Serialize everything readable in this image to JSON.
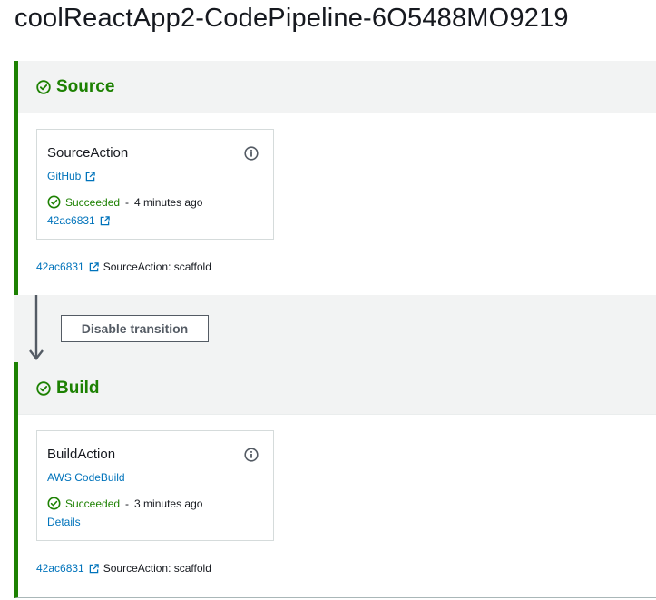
{
  "pipeline": {
    "title": "coolReactApp2-CodePipeline-6O5488MO9219"
  },
  "colors": {
    "success": "#1d8102",
    "link": "#0073bb",
    "text": "#16191f",
    "header_bg": "#f2f3f3"
  },
  "stages": [
    {
      "name": "Source",
      "action": {
        "name": "SourceAction",
        "provider": "GitHub",
        "status": "Succeeded",
        "separator": "-",
        "time": "4 minutes ago",
        "link": "42ac6831"
      },
      "footer": {
        "commit": "42ac6831",
        "message": "SourceAction: scaffold"
      }
    },
    {
      "name": "Build",
      "action": {
        "name": "BuildAction",
        "provider": "AWS CodeBuild",
        "status": "Succeeded",
        "separator": "-",
        "time": "3 minutes ago",
        "link": "Details"
      },
      "footer": {
        "commit": "42ac6831",
        "message": "SourceAction: scaffold"
      }
    }
  ],
  "transition": {
    "button_label": "Disable transition"
  },
  "icons": {
    "stage_status": "check-circle-icon",
    "info": "info-icon",
    "external": "external-link-icon",
    "transition": "arrow-down-icon"
  }
}
